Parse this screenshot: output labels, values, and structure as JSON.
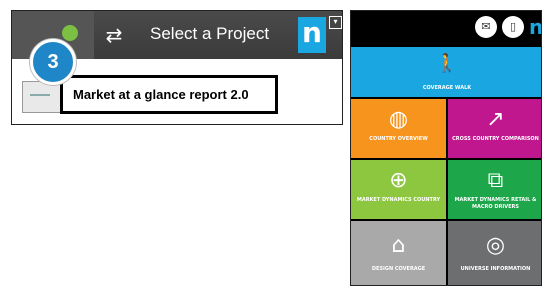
{
  "project_selector": {
    "step_number": "3",
    "title": "Select a Project",
    "refresh_icon": "refresh-icon",
    "brand_mark": "n",
    "selected_project": "Market at a glance report 2.0"
  },
  "tile_menu": {
    "header_icons": [
      "mail-icon",
      "document-icon"
    ],
    "brand_mark": "n",
    "tiles": [
      {
        "label": "COVERAGE WALK",
        "icon": "walker-icon",
        "color": "#1aa6e0"
      },
      {
        "label": "COUNTRY OVERVIEW",
        "icon": "globe-icon",
        "color": "#f7941e"
      },
      {
        "label": "CROSS COUNTRY COMPARISON",
        "icon": "line-chart-icon",
        "color": "#c0178f"
      },
      {
        "label": "MARKET DYNAMICS COUNTRY",
        "icon": "globe-arrows-icon",
        "color": "#8dc63f"
      },
      {
        "label": "MARKET DYNAMICS RETAIL & MACRO DRIVERS",
        "icon": "puzzle-icon",
        "color": "#1da74a"
      },
      {
        "label": "DESIGN COVERAGE",
        "icon": "building-check-icon",
        "color": "#a9a9a9"
      },
      {
        "label": "UNIVERSE INFORMATION",
        "icon": "target-icon",
        "color": "#6d6e70"
      }
    ]
  }
}
